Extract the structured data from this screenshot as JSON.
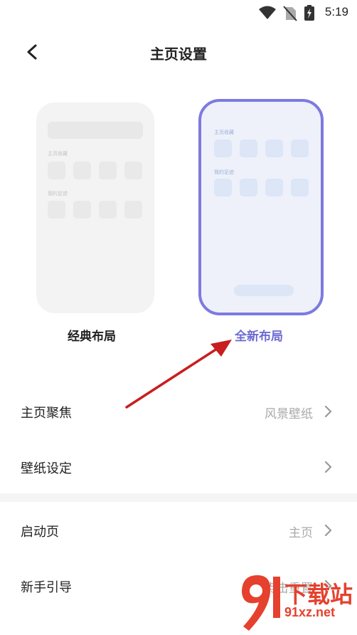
{
  "status_bar": {
    "time": "5:19",
    "icons": [
      "wifi-icon",
      "no-sim-icon",
      "battery-charging-icon"
    ]
  },
  "header": {
    "title": "主页设置",
    "back_icon": "chevron-left-icon"
  },
  "layouts": {
    "classic": {
      "label": "经典布局",
      "section1": "主页收藏",
      "section2": "我的足迹",
      "selected": false
    },
    "new": {
      "label": "全新布局",
      "section1": "主页收藏",
      "section2": "我的足迹",
      "selected": true
    }
  },
  "settings": {
    "group1": [
      {
        "label": "主页聚焦",
        "value": "风景壁纸"
      },
      {
        "label": "壁纸设定",
        "value": ""
      }
    ],
    "group2": [
      {
        "label": "启动页",
        "value": "主页"
      },
      {
        "label": "新手引导",
        "value": "点击重置"
      }
    ]
  },
  "colors": {
    "accent": "#7d7ae0",
    "accent_text": "#6e6bd2",
    "annotation_arrow": "#c81e1e"
  },
  "watermark": {
    "text": "下载站",
    "url": "91xz.net",
    "logo": "91-logo-icon"
  }
}
